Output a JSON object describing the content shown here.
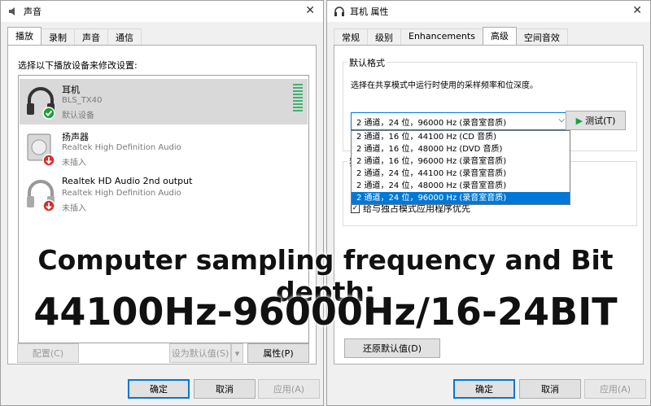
{
  "sound_window": {
    "title": "声音",
    "tabs": [
      "播放",
      "录制",
      "声音",
      "通信"
    ],
    "instruction": "选择以下播放设备来修改设置:",
    "devices": [
      {
        "name": "耳机",
        "sub": "BLS_TX40",
        "status": "默认设备"
      },
      {
        "name": "扬声器",
        "sub": "Realtek High Definition Audio",
        "status": "未插入"
      },
      {
        "name": "Realtek HD Audio 2nd output",
        "sub": "Realtek High Definition Audio",
        "status": "未插入"
      }
    ],
    "buttons": {
      "configure": "配置(C)",
      "set_default": "设为默认值(S)",
      "properties": "属性(P)",
      "ok": "确定",
      "cancel": "取消",
      "apply": "应用(A)"
    }
  },
  "props_window": {
    "title": "耳机 属性",
    "tabs": [
      "常规",
      "级别",
      "Enhancements",
      "高级",
      "空间音效"
    ],
    "group_label": "默认格式",
    "group_desc": "选择在共享模式中运行时使用的采样频率和位深度。",
    "selected_format": "2 通道，24 位，96000 Hz (录音室音质)",
    "test_button": "测试(T)",
    "options": [
      "2 通道，16 位，44100 Hz (CD 音质)",
      "2 通道，16 位，48000 Hz (DVD 音质)",
      "2 通道，16 位，96000 Hz (录音室音质)",
      "2 通道，24 位，44100 Hz (录音室音质)",
      "2 通道，24 位，48000 Hz (录音室音质)",
      "2 通道，24 位，96000 Hz (录音室音质)"
    ],
    "group2_label": "独",
    "checkbox_label": "给与独占模式应用程序优先",
    "restore_button": "还原默认值(D)",
    "buttons": {
      "ok": "确定",
      "cancel": "取消",
      "apply": "应用(A)"
    }
  },
  "overlay": {
    "line1": "Computer sampling frequency and Bit depth:",
    "line2": "44100Hz-96000Hz/16-24BIT"
  },
  "colors": {
    "accent": "#0078d7",
    "check_green": "#1e9e3a",
    "unplugged_red": "#d32f2f"
  }
}
